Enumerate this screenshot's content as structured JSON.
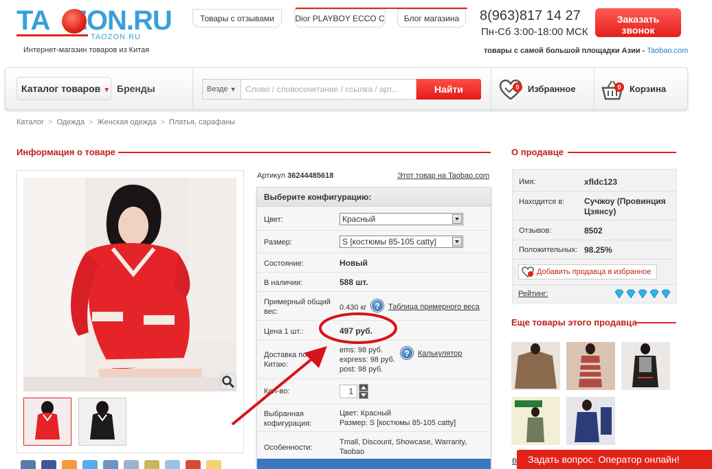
{
  "header": {
    "logo_text": "TAOZON.RU",
    "logo_domain": "TAOZON.RU",
    "tagline": "Интернет-магазин товаров из Китая",
    "tabs": [
      "Товары с отзывами",
      "Dior PLAYBOY ECCO C",
      "Блог магазина"
    ],
    "phone": "8(963)817 14 27",
    "hours": "Пн-Сб 3:00-18:00 МСК",
    "call_button": "Заказать звонок",
    "asia_text": "товары с самой большой площадки Азии - ",
    "asia_link": "Taobao.com"
  },
  "nav": {
    "catalog": "Каталог товаров",
    "brands": "Бренды",
    "search_scope": "Везде",
    "search_placeholder": "Слово / словосочетание / ссылка / арт...",
    "search_button": "Найти",
    "favorites_label": "Избранное",
    "favorites_count": "0",
    "cart_label": "Корзина",
    "cart_count": "0"
  },
  "breadcrumb": [
    "Каталог",
    "Одежда",
    "Женская одежда",
    "Платья, сарафаны"
  ],
  "product": {
    "section_title": "Информация о товаре",
    "article_label": "Артикул ",
    "article_number": "36244485618",
    "taobao_link": "Этот товар на Taobao.com",
    "config_header": "Выберите конфигурацию:",
    "rows": {
      "color_label": "Цвет:",
      "color_value": "Красный",
      "size_label": "Размер:",
      "size_value": "S [костюмы 85-105 catty]",
      "condition_label": "Состояние:",
      "condition_value": "Новый",
      "stock_label": "В наличии:",
      "stock_value": "588 шт.",
      "weight_label": "Примерный общий вес:",
      "weight_value": "0.430 кг",
      "weight_link": "Таблица примерного веса",
      "price_label": "Цена 1 шт.:",
      "price_value": "497 руб.",
      "delivery_label": "Доставка по Китаю:",
      "delivery_ems": "ems: 98 руб.",
      "delivery_express": "express: 98 руб.",
      "delivery_post": "post: 98 руб.",
      "calculator_link": "Калькулятор",
      "qty_label": "Кол-во:",
      "qty_value": "1",
      "selected_label": "Выбранная кофигурация:",
      "selected_color": "Цвет: Красный",
      "selected_size": "Размер: S [костюмы 85-105 catty]",
      "features_label": "Особенности:",
      "features_value": "Tmall, Discount, Showcase, Warranty, Taobao"
    }
  },
  "seller": {
    "section_title": "О продавце",
    "name_label": "Имя:",
    "name_value": "xfldc123",
    "location_label": "Находится в:",
    "location_value": "Сучжоу (Провинция Цзянсу)",
    "reviews_label": "Отзывов:",
    "reviews_value": "8502",
    "positive_label": "Положительных:",
    "positive_value": "98.25%",
    "add_button": "Добавить продавца в избранное",
    "rating_label": "Рейтинг:",
    "rating_diamonds": 5
  },
  "more": {
    "section_title": "Еще товары этого продавца",
    "ve_link": "Ве"
  },
  "chat": "Задать вопрос. Оператор онлайн!",
  "colors": {
    "brand_red": "#e2231a",
    "logo_blue": "#3a9fd9",
    "link_blue": "#1a7fc1"
  }
}
